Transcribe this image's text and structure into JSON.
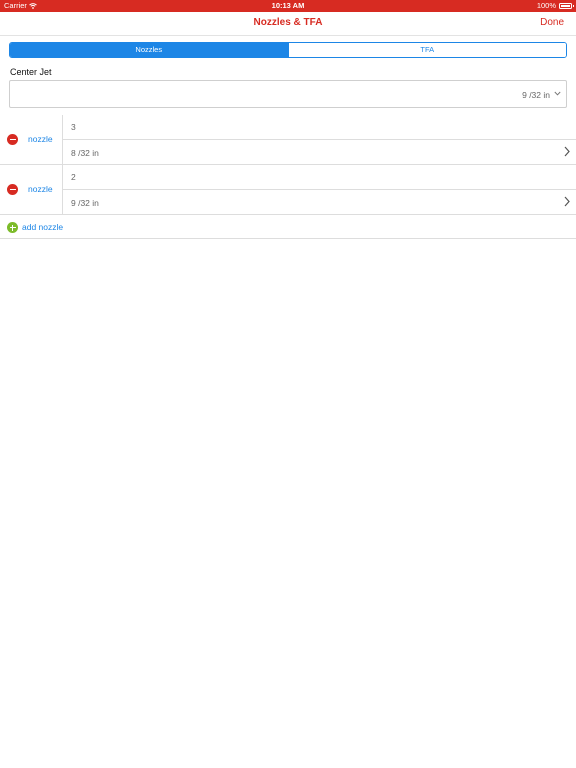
{
  "status_bar": {
    "carrier": "Carrier",
    "time": "10:13 AM",
    "battery": "100%"
  },
  "nav": {
    "title": "Nozzles & TFA",
    "done_label": "Done"
  },
  "segments": {
    "nozzles": "Nozzles",
    "tfa": "TFA",
    "selected": "Nozzles"
  },
  "center_jet": {
    "label": "Center Jet",
    "value": "9 /32 in"
  },
  "nozzles": [
    {
      "label": "nozzle",
      "count": "3",
      "size": "8 /32 in"
    },
    {
      "label": "nozzle",
      "count": "2",
      "size": "9 /32 in"
    }
  ],
  "add_nozzle_label": "add nozzle",
  "colors": {
    "brand_red": "#d72b22",
    "accent_blue": "#1d86e6",
    "add_green": "#7cbb2a"
  }
}
